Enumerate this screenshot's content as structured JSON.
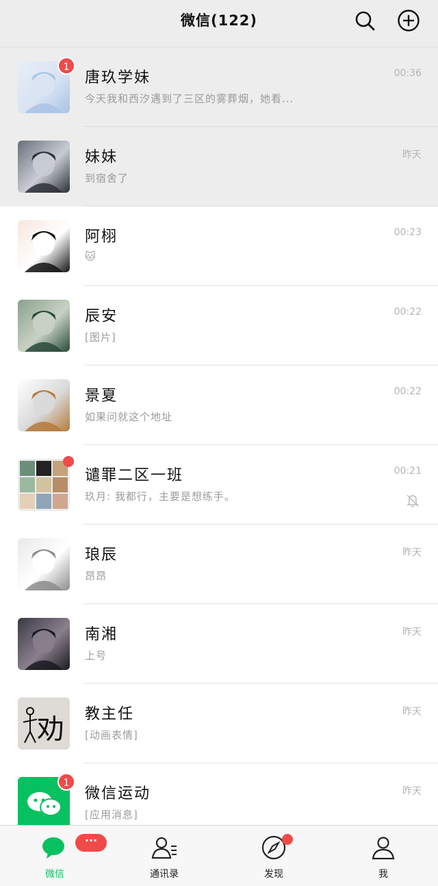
{
  "header": {
    "title": "微信(122)"
  },
  "chats": [
    {
      "name": "唐玖学妹",
      "preview": "今天我和西汐遇到了三区的雾葬烟，她看...",
      "time": "00:36",
      "badge": "1",
      "pinned": true,
      "avatar_colors": [
        "#e7eef7",
        "#a9c3e6",
        "#d9e3f2"
      ]
    },
    {
      "name": "妹妹",
      "preview": "到宿舍了",
      "time": "昨天",
      "pinned": true,
      "avatar_colors": [
        "#6a6f7a",
        "#2d3038",
        "#c9ccd4"
      ]
    },
    {
      "name": "阿栩",
      "preview": "🐱",
      "time": "00:23",
      "avatar_colors": [
        "#f7e6dc",
        "#141414",
        "#ffffff"
      ]
    },
    {
      "name": "辰安",
      "preview": "[图片]",
      "time": "00:22",
      "avatar_colors": [
        "#8aa08d",
        "#2a4a38",
        "#c8d2c4"
      ]
    },
    {
      "name": "景夏",
      "preview": "如果问就这个地址",
      "time": "00:22",
      "avatar_colors": [
        "#ffffff",
        "#b47a3c",
        "#d9d9d9"
      ]
    },
    {
      "name": "谴罪二区一班",
      "preview": "玖月: 我都行，主要是想练手。",
      "time": "00:21",
      "dot": true,
      "muted": true,
      "avatar_colors": [
        "#d8d8d8",
        "#6c8e7a",
        "#c4a27a"
      ]
    },
    {
      "name": "琅辰",
      "preview": "昂昂",
      "time": "昨天",
      "avatar_colors": [
        "#e9e9e9",
        "#8c8c8c",
        "#ffffff"
      ]
    },
    {
      "name": "南湘",
      "preview": "上号",
      "time": "昨天",
      "avatar_colors": [
        "#3a3a44",
        "#1a1a1f",
        "#8a7f8c"
      ]
    },
    {
      "name": "教主任",
      "preview": "[动画表情]",
      "time": "昨天",
      "avatar_colors": [
        "#dedad6",
        "#111111",
        "#dedad6"
      ],
      "avatar_text": "劝"
    },
    {
      "name": "微信运动",
      "preview": "[应用消息]",
      "time": "昨天",
      "badge": "1",
      "avatar_colors": [
        "#07c160",
        "#ffffff",
        "#07c160"
      ]
    }
  ],
  "tabbar": {
    "tabs": [
      {
        "label": "微信",
        "active": true,
        "pill": "···"
      },
      {
        "label": "通讯录"
      },
      {
        "label": "发现",
        "dot": true
      },
      {
        "label": "我"
      }
    ]
  },
  "colors": {
    "accent": "#07c160",
    "badge": "#f04a4a",
    "header_bg": "#ededed"
  }
}
